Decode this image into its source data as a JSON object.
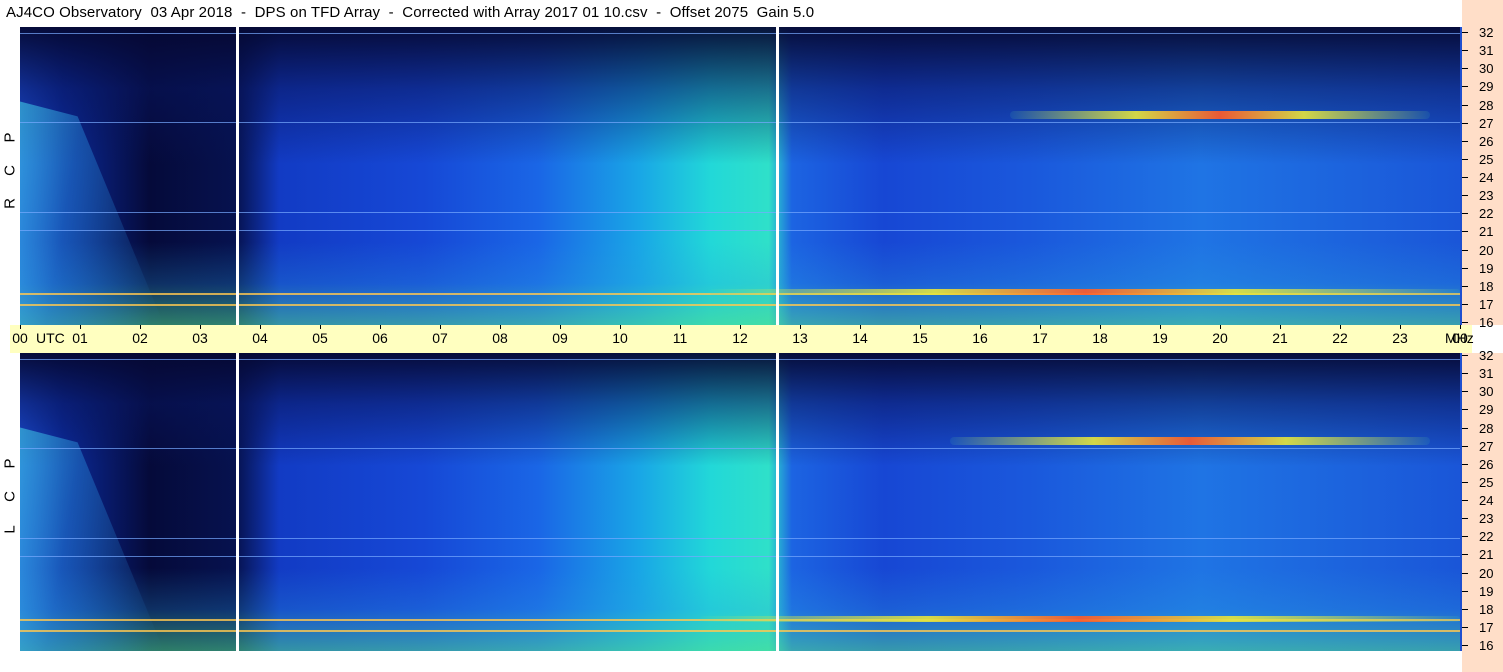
{
  "title": "AJ4CO Observatory  03 Apr 2018  -  DPS on TFD Array  -  Corrected with Array 2017 01 10.csv  -  Offset 2075  Gain 5.0",
  "colors": {
    "time_axis_bg": "#ffffc0",
    "freq_axis_bg": "#ffdec8",
    "dark": "#050a3a",
    "mid": "#1a58dc",
    "bright": "#2fe0c9"
  },
  "chart_data": {
    "type": "heatmap",
    "title": "AJ4CO Observatory  03 Apr 2018  -  DPS on TFD Array  -  Corrected with Array 2017 01 10.csv  -  Offset 2075  Gain 5.0",
    "x_axis": {
      "unit_label": "UTC",
      "ticks": [
        "00",
        "01",
        "02",
        "03",
        "04",
        "05",
        "06",
        "07",
        "08",
        "09",
        "10",
        "11",
        "12",
        "13",
        "14",
        "15",
        "16",
        "17",
        "18",
        "19",
        "20",
        "21",
        "22",
        "23",
        "00"
      ],
      "range_hours": [
        0,
        24
      ]
    },
    "y_axis": {
      "unit_label": "MHz",
      "ticks": [
        "32",
        "31",
        "30",
        "29",
        "28",
        "27",
        "26",
        "25",
        "24",
        "23",
        "22",
        "21",
        "20",
        "19",
        "18",
        "17",
        "16"
      ],
      "range_mhz": [
        16,
        32
      ]
    },
    "panels": [
      {
        "name": "R C P",
        "letters": [
          "R",
          "C",
          "P"
        ]
      },
      {
        "name": "L C P",
        "letters": [
          "L",
          "C",
          "P"
        ]
      }
    ],
    "data_gaps_utc": [
      3.6,
      12.6
    ]
  }
}
